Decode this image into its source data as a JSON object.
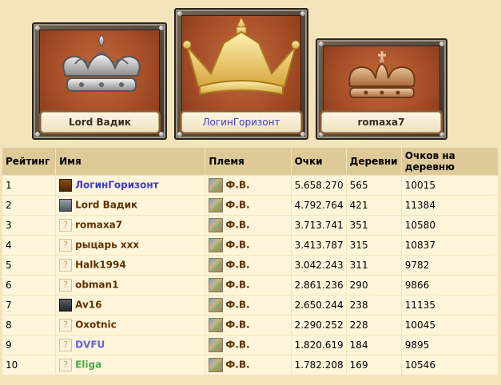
{
  "podium": {
    "first": {
      "name": "ЛогинГоризонт",
      "crown": "gold-crown-icon"
    },
    "second": {
      "name": "Lord Вадик",
      "crown": "silver-crown-icon"
    },
    "third": {
      "name": "romaxa7",
      "crown": "bronze-crown-icon"
    }
  },
  "table": {
    "headers": {
      "rank": "Рейтинг",
      "name": "Имя",
      "tribe": "Племя",
      "points": "Очки",
      "villages": "Деревни",
      "per_village": "Очков на деревню"
    },
    "rows": [
      {
        "rank": "1",
        "name": "ЛогинГоризонт",
        "tribe": "Ф.В.",
        "points": "5.658.270",
        "villages": "565",
        "per_village": "10015"
      },
      {
        "rank": "2",
        "name": "Lord Вадик",
        "tribe": "Ф.В.",
        "points": "4.792.764",
        "villages": "421",
        "per_village": "11384"
      },
      {
        "rank": "3",
        "name": "romaxa7",
        "tribe": "Ф.В.",
        "points": "3.713.741",
        "villages": "351",
        "per_village": "10580"
      },
      {
        "rank": "4",
        "name": "рыцарь ххх",
        "tribe": "Ф.В.",
        "points": "3.413.787",
        "villages": "315",
        "per_village": "10837"
      },
      {
        "rank": "5",
        "name": "Halk1994",
        "tribe": "Ф.В.",
        "points": "3.042.243",
        "villages": "311",
        "per_village": "9782"
      },
      {
        "rank": "6",
        "name": "obman1",
        "tribe": "Ф.В.",
        "points": "2.861.236",
        "villages": "290",
        "per_village": "9866"
      },
      {
        "rank": "7",
        "name": "Av16",
        "tribe": "Ф.В.",
        "points": "2.650.244",
        "villages": "238",
        "per_village": "11135"
      },
      {
        "rank": "8",
        "name": "Oxotnic",
        "tribe": "Ф.В.",
        "points": "2.290.252",
        "villages": "228",
        "per_village": "10045"
      },
      {
        "rank": "9",
        "name": "DVFU",
        "tribe": "Ф.В.",
        "points": "1.820.619",
        "villages": "184",
        "per_village": "9895"
      },
      {
        "rank": "10",
        "name": "Eliga",
        "tribe": "Ф.В.",
        "points": "1.782.208",
        "villages": "169",
        "per_village": "10546"
      }
    ]
  },
  "colors": {
    "background": "#f4e4bc",
    "header_bg": "#dec998",
    "row_bg": "#fff5da",
    "own_player": "#3b3bd4",
    "player_link": "#603000"
  }
}
